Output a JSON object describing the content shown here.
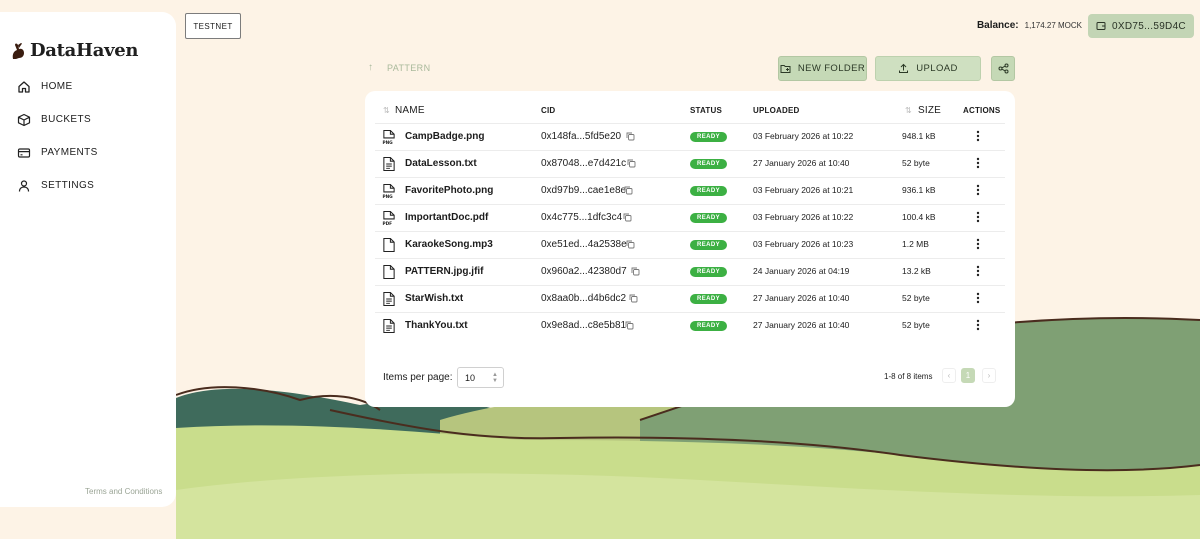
{
  "brand": {
    "name": "DataHaven"
  },
  "sidebar": {
    "items": [
      {
        "label": "HOME",
        "icon": "home-icon"
      },
      {
        "label": "BUCKETS",
        "icon": "buckets-icon"
      },
      {
        "label": "PAYMENTS",
        "icon": "card-icon"
      },
      {
        "label": "SETTINGS",
        "icon": "user-icon"
      }
    ],
    "terms": "Terms and Conditions"
  },
  "topbar": {
    "network": "TESTNET",
    "balance_label": "Balance:",
    "balance_value": "1,174.27 MOCK",
    "wallet": "0XD75...59D4C"
  },
  "toolbar": {
    "breadcrumb": "PATTERN",
    "new_folder": "NEW FOLDER",
    "upload": "UPLOAD"
  },
  "table": {
    "columns": {
      "name": "NAME",
      "cid": "CID",
      "status": "STATUS",
      "uploaded": "UPLOADED",
      "size": "SIZE",
      "actions": "ACTIONS"
    },
    "rows": [
      {
        "name": "CampBadge.png",
        "type": "png",
        "cid": "0x148fa...5fd5e20",
        "status": "READY",
        "uploaded": "03 February 2026 at 10:22",
        "size": "948.1 kB"
      },
      {
        "name": "DataLesson.txt",
        "type": "txt",
        "cid": "0x87048...e7d421c",
        "status": "READY",
        "uploaded": "27 January 2026 at 10:40",
        "size": "52 byte"
      },
      {
        "name": "FavoritePhoto.png",
        "type": "png",
        "cid": "0xd97b9...cae1e8e",
        "status": "READY",
        "uploaded": "03 February 2026 at 10:21",
        "size": "936.1 kB"
      },
      {
        "name": "ImportantDoc.pdf",
        "type": "pdf",
        "cid": "0x4c775...1dfc3c4",
        "status": "READY",
        "uploaded": "03 February 2026 at 10:22",
        "size": "100.4 kB"
      },
      {
        "name": "KaraokeSong.mp3",
        "type": "file",
        "cid": "0xe51ed...4a2538e",
        "status": "READY",
        "uploaded": "03 February 2026 at 10:23",
        "size": "1.2 MB"
      },
      {
        "name": "PATTERN.jpg.jfif",
        "type": "file",
        "cid": "0x960a2...42380d7",
        "status": "READY",
        "uploaded": "24 January 2026 at 04:19",
        "size": "13.2 kB"
      },
      {
        "name": "StarWish.txt",
        "type": "txt",
        "cid": "0x8aa0b...d4b6dc2",
        "status": "READY",
        "uploaded": "27 January 2026 at 10:40",
        "size": "52 byte"
      },
      {
        "name": "ThankYou.txt",
        "type": "txt",
        "cid": "0x9e8ad...c8e5b81",
        "status": "READY",
        "uploaded": "27 January 2026 at 10:40",
        "size": "52 byte"
      }
    ]
  },
  "pagination": {
    "items_per_page_label": "Items per page:",
    "items_per_page": "10",
    "range": "1-8 of 8 items",
    "current_page": "1"
  },
  "colors": {
    "accent": "#c5d9b6",
    "ready": "#3cb043",
    "background": "#fdf3e6"
  }
}
